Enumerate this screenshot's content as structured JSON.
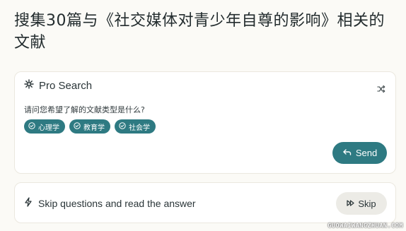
{
  "page": {
    "title": "搜集30篇与《社交媒体对青少年自尊的影响》相关的文献"
  },
  "pro_search": {
    "header_label": "Pro Search",
    "header_icon": "sparkle-icon",
    "shuffle_icon": "shuffle-icon",
    "question": "请问您希望了解的文献类型是什么?",
    "options": [
      {
        "label": "心理学",
        "icon": "check-circle-icon"
      },
      {
        "label": "教育学",
        "icon": "check-circle-icon"
      },
      {
        "label": "社会学",
        "icon": "check-circle-icon"
      }
    ],
    "send_label": "Send",
    "send_icon": "reply-arrow-icon"
  },
  "skip_card": {
    "text": "Skip questions and read the answer",
    "bolt_icon": "bolt-icon",
    "skip_label": "Skip",
    "skip_icon": "fast-forward-icon"
  },
  "watermark": "GUOWAIWANGZHUAN.COM",
  "colors": {
    "accent": "#2e7a82",
    "background": "#fbfaf6",
    "card": "#ffffff",
    "skip_button": "#ecebe6"
  }
}
